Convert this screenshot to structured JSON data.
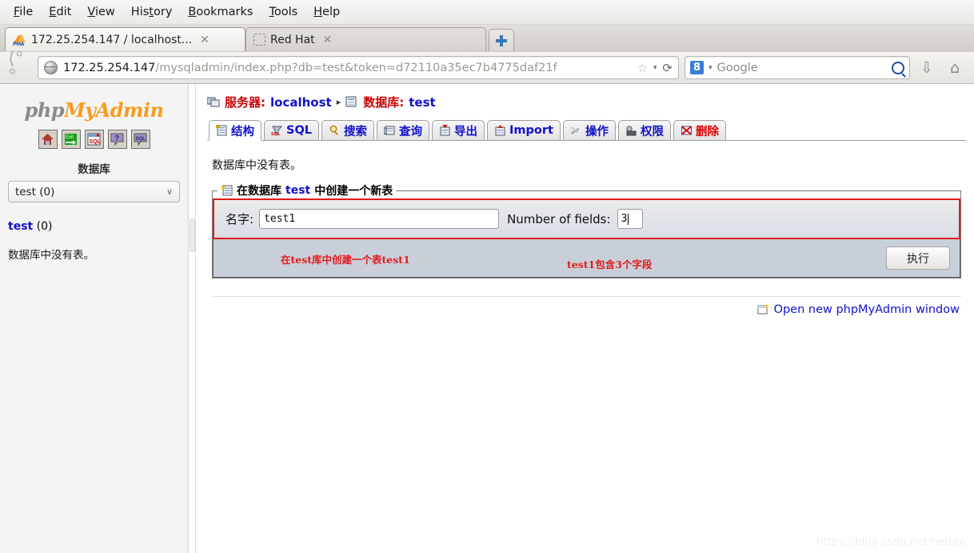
{
  "browser": {
    "menu": [
      "File",
      "Edit",
      "View",
      "History",
      "Bookmarks",
      "Tools",
      "Help"
    ],
    "tabs": [
      {
        "label": "172.25.254.147 / localhost...",
        "icon": "phpmyadmin-favicon",
        "active": true,
        "close": "✕"
      },
      {
        "label": "Red Hat",
        "icon": "blank-favicon",
        "active": false,
        "close": "✕"
      }
    ],
    "new_tab_tooltip": "+",
    "url_host": "172.25.254.147",
    "url_path": "/mysqladmin/index.php?db=test&token=d72110a35ec7b4775daf21f",
    "search_engine": "8",
    "search_placeholder": "Google",
    "back_icon": "back-arrow-icon",
    "star_icon": "☆",
    "caret_icon": "▾",
    "reload_icon": "⟳",
    "download_icon": "⇩",
    "home_icon": "⌂"
  },
  "sidebar": {
    "logo_part1": "php",
    "logo_part2": "MyAdmin",
    "icons": [
      "home-icon",
      "logout-icon",
      "sql-query-window-icon",
      "help-icon",
      "sql-docs-icon"
    ],
    "databases_heading": "数据库",
    "db_select_value": "test (0)",
    "db_select_caret": "∨",
    "db_link": "test",
    "db_count": "(0)",
    "no_tables": "数据库中没有表。"
  },
  "main": {
    "breadcrumb": {
      "server_label": "服务器:",
      "server_value": "localhost",
      "separator": "▸",
      "db_label": "数据库:",
      "db_value": "test",
      "server_icon": "server-icon",
      "db_icon": "database-icon"
    },
    "tabs": [
      {
        "label": "结构",
        "icon": "structure-icon",
        "active": true,
        "drop": false
      },
      {
        "label": "SQL",
        "icon": "sql-icon",
        "active": false,
        "drop": false
      },
      {
        "label": "搜索",
        "icon": "search-icon",
        "active": false,
        "drop": false
      },
      {
        "label": "查询",
        "icon": "query-icon",
        "active": false,
        "drop": false
      },
      {
        "label": "导出",
        "icon": "export-icon",
        "active": false,
        "drop": false
      },
      {
        "label": "Import",
        "icon": "import-icon",
        "active": false,
        "drop": false
      },
      {
        "label": "操作",
        "icon": "operations-icon",
        "active": false,
        "drop": false
      },
      {
        "label": "权限",
        "icon": "privileges-icon",
        "active": false,
        "drop": false
      },
      {
        "label": "删除",
        "icon": "drop-icon",
        "active": false,
        "drop": true
      }
    ],
    "no_tables_msg": "数据库中没有表。",
    "create_form": {
      "legend_icon": "new-table-icon",
      "legend_prefix": "在数据库",
      "legend_db": "test",
      "legend_suffix": "中创建一个新表",
      "name_label": "名字:",
      "name_value": "test1",
      "fields_label": "Number of fields:",
      "fields_value": "3",
      "submit_label": "执行",
      "annotation_left": "在test库中创建一个表test1",
      "annotation_right": "test1包含3个字段"
    },
    "open_window_link": "Open new phpMyAdmin window",
    "open_window_icon": "new-window-icon"
  },
  "watermark": "https://blog.csdn.net/hetoto",
  "colors": {
    "accent_link": "#1111cc",
    "breadcrumb_red": "#cc0000",
    "annotation_red": "#e01b1b",
    "logo_orange": "#f79c1e"
  }
}
